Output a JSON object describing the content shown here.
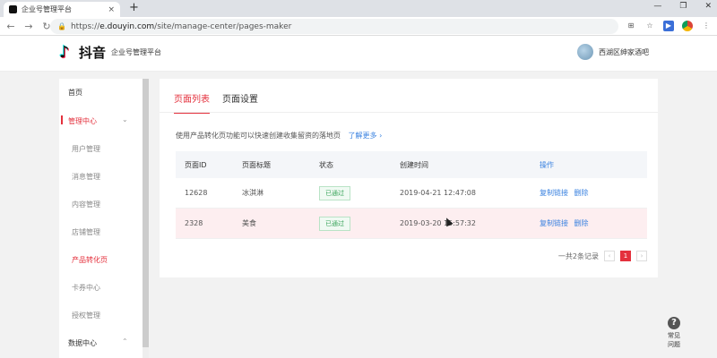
{
  "browser": {
    "tab_title": "企业号管理平台",
    "tab_close": "×",
    "new_tab": "+",
    "url_host": "e.douyin.com",
    "url_prefix": "https://",
    "url_path": "/site/manage-center/pages-maker",
    "back": "←",
    "forward": "→",
    "reload": "↻",
    "window_controls": [
      "—",
      "❐",
      "✕"
    ]
  },
  "header": {
    "logo_text": "抖音",
    "logo_sub": "企业号管理平台",
    "user_name": "西湖区绅家酒吧"
  },
  "sidebar": {
    "items": [
      {
        "label": "首页",
        "type": "group"
      },
      {
        "label": "管理中心",
        "type": "active-group",
        "chevron": "⌄"
      },
      {
        "label": "用户管理",
        "type": "sub"
      },
      {
        "label": "消息管理",
        "type": "sub"
      },
      {
        "label": "内容管理",
        "type": "sub"
      },
      {
        "label": "店铺管理",
        "type": "sub"
      },
      {
        "label": "产品转化页",
        "type": "selected"
      },
      {
        "label": "卡券中心",
        "type": "sub"
      },
      {
        "label": "授权管理",
        "type": "sub"
      },
      {
        "label": "数据中心",
        "type": "group",
        "chevron": "⌃"
      }
    ]
  },
  "main": {
    "tabs": [
      {
        "label": "页面列表",
        "active": true
      },
      {
        "label": "页面设置",
        "active": false
      }
    ],
    "intro_text": "使用产品转化页功能可以快速创建收集留资的落地页",
    "intro_link": "了解更多 ›",
    "table": {
      "headers": [
        "页面ID",
        "页面标题",
        "状态",
        "创建时间",
        "操作"
      ],
      "rows": [
        {
          "id": "12628",
          "title": "冰淇淋",
          "status": "已通过",
          "created": "2019-04-21 12:47:08",
          "ops": [
            "复制链接",
            "删除"
          ],
          "highlight": false
        },
        {
          "id": "2328",
          "title": "美食",
          "status": "已通过",
          "created": "2019-03-20 15:57:32",
          "ops": [
            "复制链接",
            "删除"
          ],
          "highlight": true
        }
      ]
    },
    "pager": {
      "total_text": "一共2条记录",
      "prev": "‹",
      "current": "1",
      "next": "›"
    }
  },
  "help": {
    "icon": "?",
    "label_line1": "常见",
    "label_line2": "问题"
  },
  "colors": {
    "accent": "#e4313d",
    "link": "#3a82e0",
    "success": "#3ba55c"
  }
}
